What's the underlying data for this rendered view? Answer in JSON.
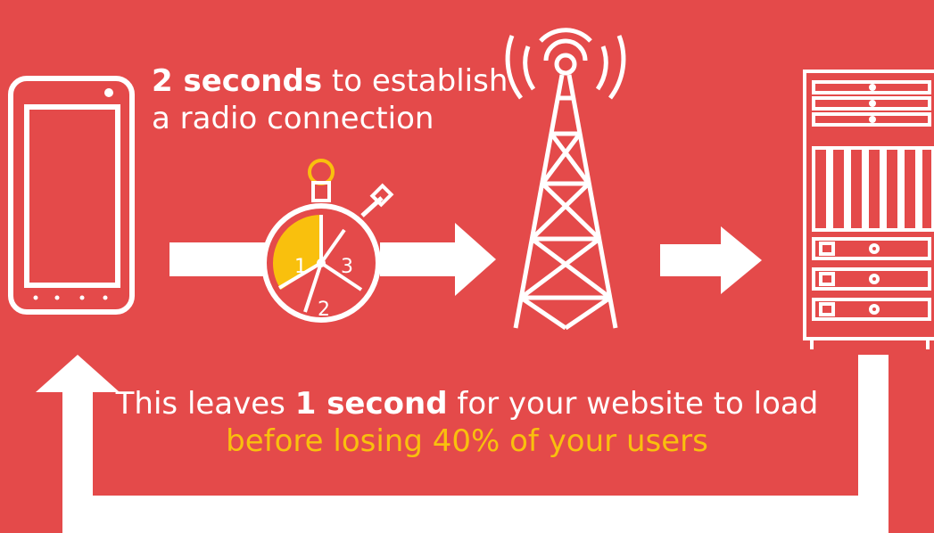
{
  "top_caption": {
    "bold": "2 seconds",
    "rest_line1": " to establish",
    "line2": "a radio connection"
  },
  "stopwatch": {
    "labels": [
      "1",
      "2",
      "3"
    ]
  },
  "bottom_caption": {
    "prefix": "This leaves ",
    "bold": "1 second",
    "suffix": " for your website to load",
    "line2": "before losing 40% of your users"
  },
  "colors": {
    "background": "#e44a4a",
    "foreground": "#ffffff",
    "highlight": "#f9c00d"
  }
}
